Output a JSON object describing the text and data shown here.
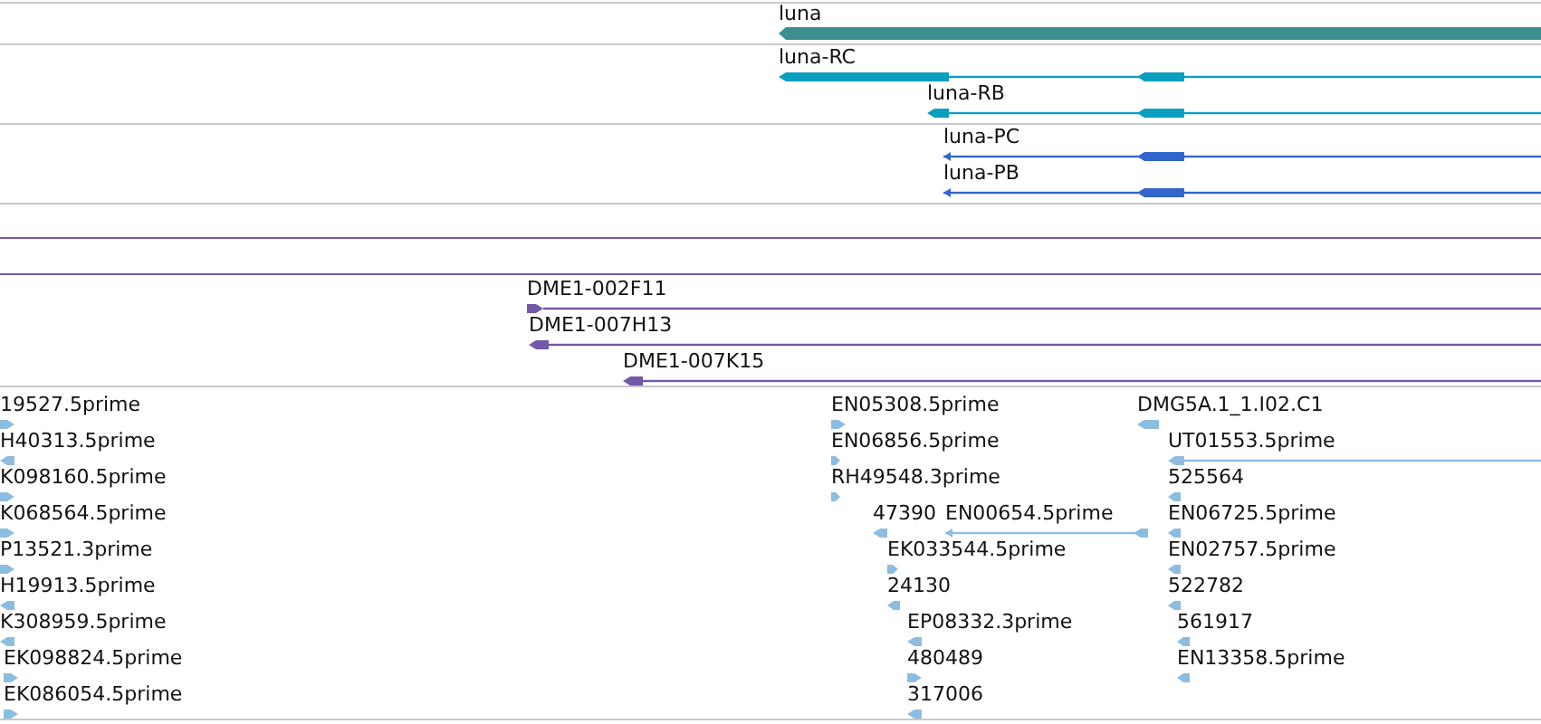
{
  "tracks": [
    {
      "kind": "gene",
      "features": [
        {
          "label": "luna",
          "kind": "reverse"
        }
      ]
    },
    {
      "kind": "transcript",
      "features": [
        {
          "label": "luna-RC",
          "kind": "reverse"
        },
        {
          "label": "luna-RB",
          "kind": "reverse"
        }
      ]
    },
    {
      "kind": "protein",
      "features": [
        {
          "label": "luna-PC",
          "kind": "reverse"
        },
        {
          "label": "luna-PB",
          "kind": "reverse"
        }
      ]
    },
    {
      "kind": "blank"
    },
    {
      "kind": "clone"
    },
    {
      "kind": "clone",
      "features": [
        {
          "label": "DME1-002F11",
          "kind": "forward"
        },
        {
          "label": "DME1-007H13",
          "kind": "reverse"
        },
        {
          "label": "DME1-007K15",
          "kind": "reverse"
        }
      ]
    },
    {
      "kind": "est",
      "features": [
        {
          "label": "19527.5prime",
          "kind": "forward"
        },
        {
          "label": "H40313.5prime",
          "kind": "reverse"
        },
        {
          "label": "K098160.5prime",
          "kind": "forward"
        },
        {
          "label": "K068564.5prime",
          "kind": "forward"
        },
        {
          "label": "P13521.3prime",
          "kind": "forward"
        },
        {
          "label": "H19913.5prime",
          "kind": "reverse"
        },
        {
          "label": "K308959.5prime",
          "kind": "reverse"
        },
        {
          "label": "EK098824.5prime",
          "kind": "forward"
        },
        {
          "label": "EK086054.5prime",
          "kind": "forward"
        },
        {
          "label": "EN05308.5prime",
          "kind": "forward"
        },
        {
          "label": "EN06856.5prime",
          "kind": "forward"
        },
        {
          "label": "RH49548.3prime",
          "kind": "forward"
        },
        {
          "label": "47390",
          "kind": "reverse"
        },
        {
          "label": "EN00654.5prime",
          "kind": "reverse"
        },
        {
          "label": "EK033544.5prime",
          "kind": "forward"
        },
        {
          "label": "24130",
          "kind": "reverse"
        },
        {
          "label": "EP08332.3prime",
          "kind": "reverse"
        },
        {
          "label": "480489",
          "kind": "forward"
        },
        {
          "label": "317006",
          "kind": "reverse"
        },
        {
          "label": "DMG5A.1_1.I02.C1",
          "kind": "reverse"
        },
        {
          "label": "UT01553.5prime",
          "kind": "reverse"
        },
        {
          "label": "525564",
          "kind": "reverse"
        },
        {
          "label": "EN06725.5prime",
          "kind": "reverse"
        },
        {
          "label": "EN02757.5prime",
          "kind": "reverse"
        },
        {
          "label": "522782",
          "kind": "reverse"
        },
        {
          "label": "561917",
          "kind": "reverse"
        },
        {
          "label": "EN13358.5prime",
          "kind": "reverse"
        }
      ]
    }
  ]
}
